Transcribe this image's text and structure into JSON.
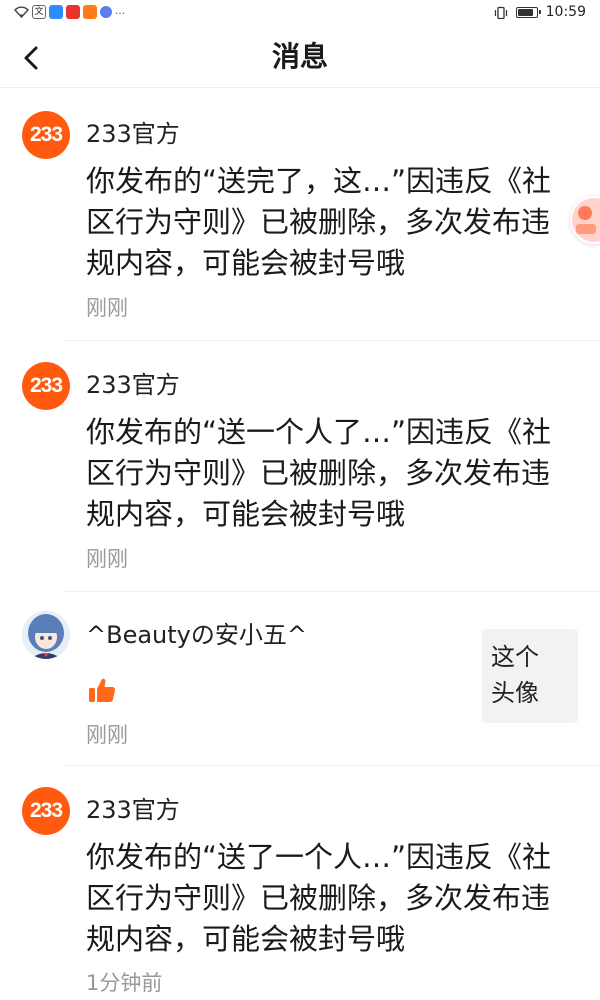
{
  "status_bar": {
    "left_text": "…",
    "time": "10:59",
    "battery_level": 0.85
  },
  "header": {
    "title": "消息",
    "back_icon": "chevron-left-icon"
  },
  "messages": [
    {
      "sender": "233官方",
      "avatar_text": "233",
      "body": "你发布的“送完了，这…”因违反《社区行为守则》已被删除，多次发布违规内容，可能会被封号哦",
      "time": "刚刚"
    },
    {
      "sender": "233官方",
      "avatar_text": "233",
      "body": "你发布的“送一个人了…”因违反《社区行为守则》已被删除，多次发布违规内容，可能会被封号哦",
      "time": "刚刚"
    },
    {
      "sender": "^Beautyの安小五^",
      "icon": "thumbs-up-icon",
      "time": "刚刚",
      "preview_text": "这个头像"
    },
    {
      "sender": "233官方",
      "avatar_text": "233",
      "body": "你发布的“送了一个人…”因违反《社区行为守则》已被删除，多次发布违规内容，可能会被封号哦",
      "time": "1分钟前"
    }
  ],
  "colors": {
    "brand_orange": "#ff5a10",
    "like_orange": "#ff6a1a",
    "time_gray": "#999999"
  }
}
